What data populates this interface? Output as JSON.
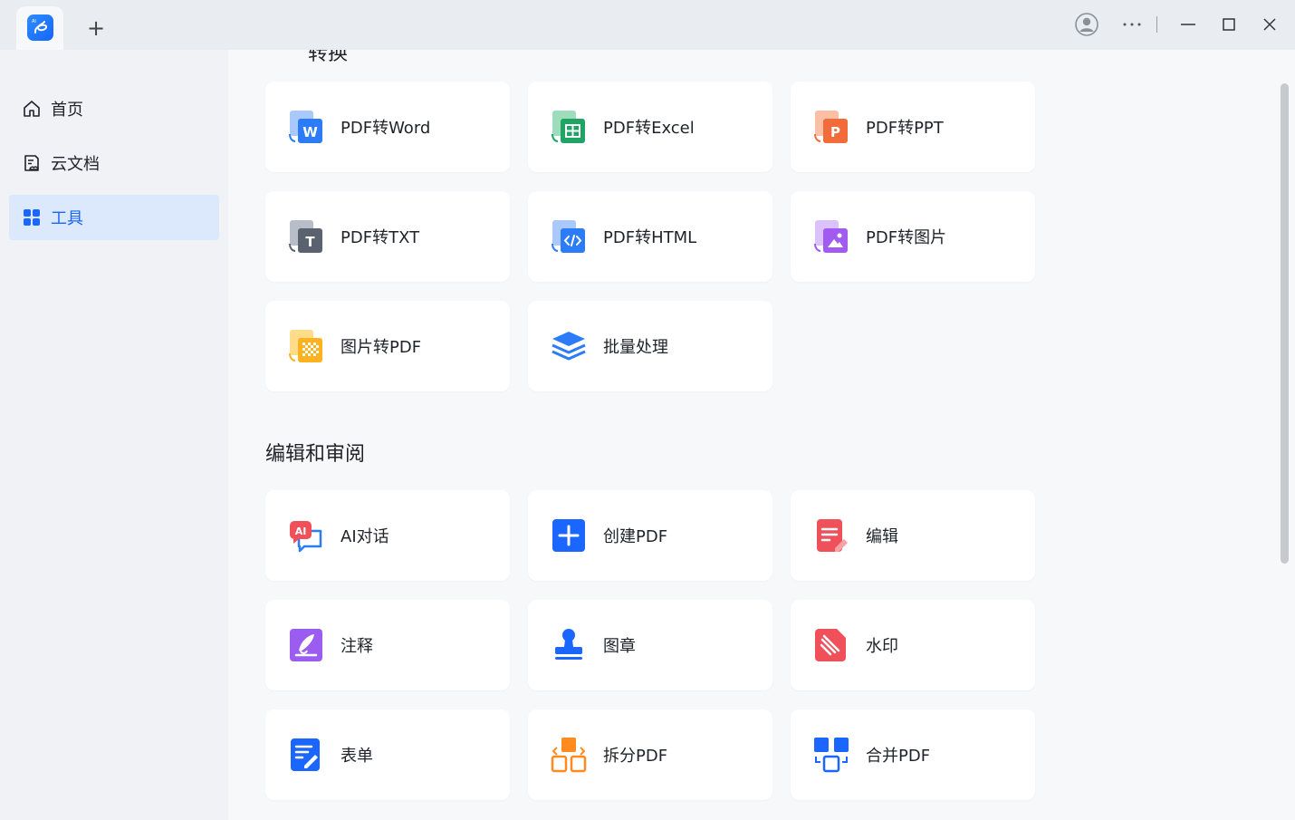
{
  "titlebar": {
    "app_icon": "app-logo-icon",
    "new_tab_symbol": "+",
    "controls": [
      "user-avatar-icon",
      "more-icon",
      "minimize-icon",
      "maximize-icon",
      "close-icon"
    ]
  },
  "sidebar": {
    "items": [
      {
        "label": "首页",
        "icon": "home-icon",
        "active": false
      },
      {
        "label": "云文档",
        "icon": "cloud-doc-icon",
        "active": false
      },
      {
        "label": "工具",
        "icon": "tools-grid-icon",
        "active": true
      }
    ]
  },
  "main": {
    "section_convert_title_cut": "转换",
    "convert_tools": [
      {
        "label": "PDF转Word",
        "icon": "pdf-to-word-icon"
      },
      {
        "label": "PDF转Excel",
        "icon": "pdf-to-excel-icon"
      },
      {
        "label": "PDF转PPT",
        "icon": "pdf-to-ppt-icon"
      },
      {
        "label": "PDF转TXT",
        "icon": "pdf-to-txt-icon"
      },
      {
        "label": "PDF转HTML",
        "icon": "pdf-to-html-icon"
      },
      {
        "label": "PDF转图片",
        "icon": "pdf-to-image-icon"
      },
      {
        "label": "图片转PDF",
        "icon": "image-to-pdf-icon"
      },
      {
        "label": "批量处理",
        "icon": "batch-layers-icon"
      }
    ],
    "section_edit_title": "编辑和审阅",
    "edit_tools": [
      {
        "label": "AI对话",
        "icon": "ai-chat-icon"
      },
      {
        "label": "创建PDF",
        "icon": "create-pdf-icon"
      },
      {
        "label": "编辑",
        "icon": "edit-icon"
      },
      {
        "label": "注释",
        "icon": "annotate-icon"
      },
      {
        "label": "图章",
        "icon": "stamp-icon"
      },
      {
        "label": "水印",
        "icon": "watermark-icon"
      },
      {
        "label": "表单",
        "icon": "form-icon"
      },
      {
        "label": "拆分PDF",
        "icon": "split-pdf-icon"
      },
      {
        "label": "合并PDF",
        "icon": "merge-pdf-icon"
      }
    ]
  },
  "colors": {
    "accent": "#1a66ff",
    "active_bg": "#dce8fb",
    "word": "#2b7cf6",
    "excel": "#1fa463",
    "ppt": "#f26b3a",
    "txt": "#5a6270",
    "image": "#a25bf0",
    "red": "#f0505a",
    "orange": "#ff8a1f"
  }
}
